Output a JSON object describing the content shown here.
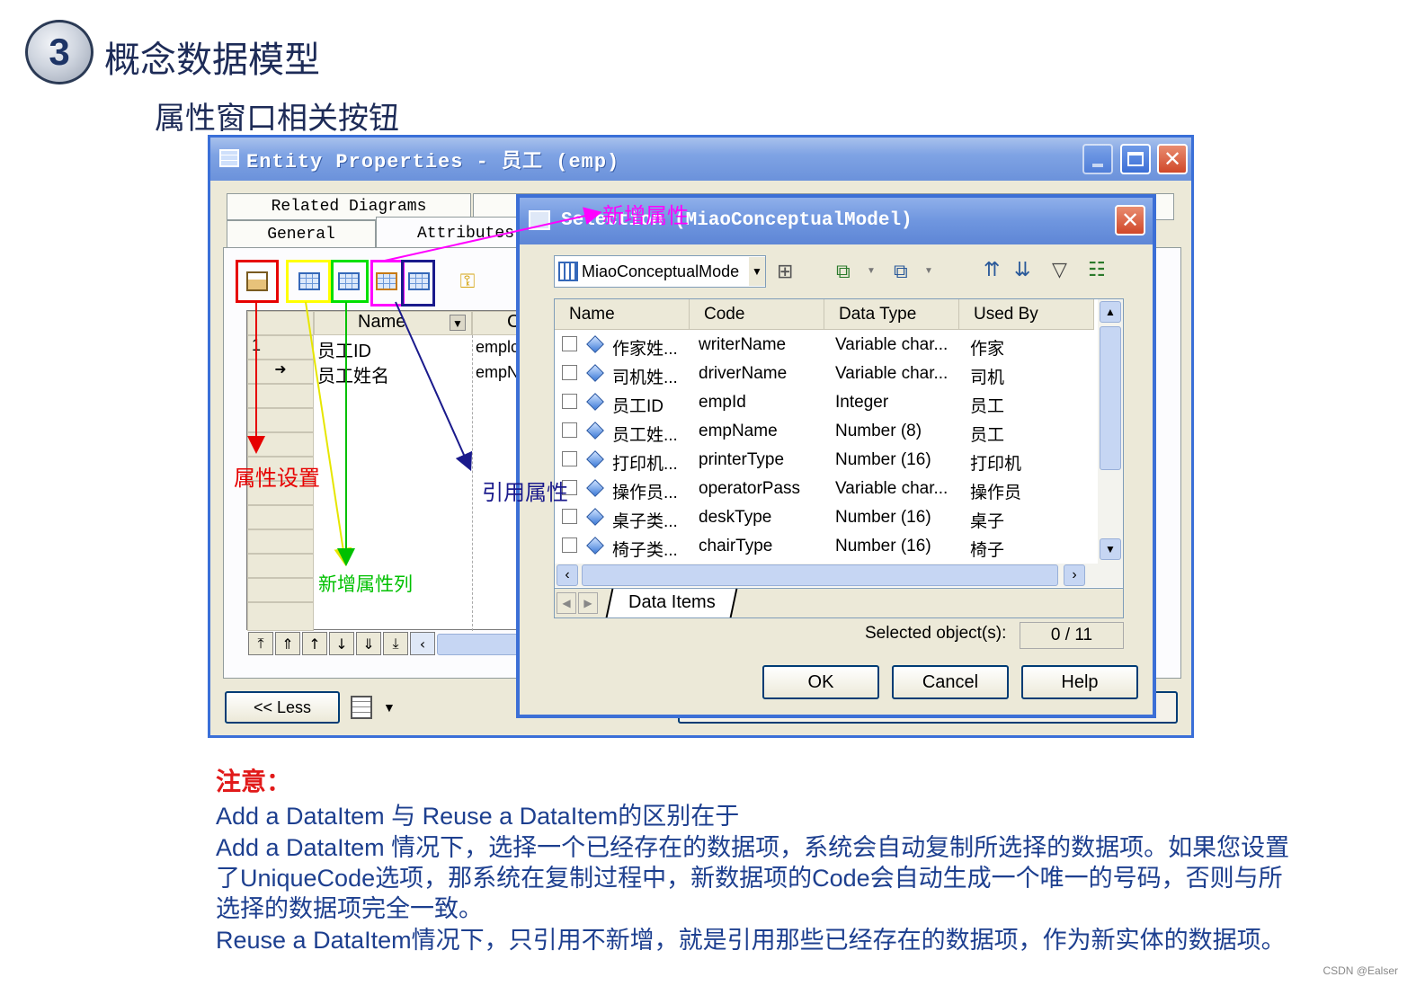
{
  "slide": {
    "number": "3",
    "title": "概念数据模型",
    "subtitle": "属性窗口相关按钮"
  },
  "entity_window": {
    "title": "Entity Properties - 员工 (emp)",
    "tabs_row1": [
      "Related Diagrams",
      ""
    ],
    "tabs_row2": [
      "General",
      "Attributes"
    ],
    "grid": {
      "column_name": "Name",
      "column_code": "C",
      "rows": [
        {
          "num": "1",
          "name": "员工ID",
          "code": "emplc"
        },
        {
          "num": "",
          "name": "员工姓名",
          "code": "empN"
        }
      ]
    },
    "less_button": "<< Less"
  },
  "selection_dialog": {
    "title": "Selection (MiaoConceptualModel)",
    "model_combo": "MiaoConceptualMode",
    "columns": [
      "Name",
      "Code",
      "Data Type",
      "Used By"
    ],
    "rows": [
      {
        "name": "作家姓...",
        "code": "writerName",
        "type": "Variable char...",
        "used_by": "作家"
      },
      {
        "name": "司机姓...",
        "code": "driverName",
        "type": "Variable char...",
        "used_by": "司机"
      },
      {
        "name": "员工ID",
        "code": "empId",
        "type": "Integer",
        "used_by": "员工"
      },
      {
        "name": "员工姓...",
        "code": "empName",
        "type": "Number (8)",
        "used_by": "员工"
      },
      {
        "name": "打印机...",
        "code": "printerType",
        "type": "Number (16)",
        "used_by": "打印机"
      },
      {
        "name": "操作员...",
        "code": "operatorPass",
        "type": "Variable char...",
        "used_by": "操作员"
      },
      {
        "name": "桌子类...",
        "code": "deskType",
        "type": "Number (16)",
        "used_by": "桌子"
      },
      {
        "name": "椅子类...",
        "code": "chairType",
        "type": "Number (16)",
        "used_by": "椅子"
      }
    ],
    "tab_label": "Data Items",
    "selected_label": "Selected object(s):",
    "selected_value": "0 / 11",
    "ok": "OK",
    "cancel": "Cancel",
    "help": "Help"
  },
  "annotations": {
    "add_attribute": "新增属性",
    "attribute_settings": "属性设置",
    "reuse_attribute": "引用属性",
    "add_attribute_column": "新增属性列"
  },
  "colors": {
    "red": "#e60000",
    "yellow": "#ffff00",
    "green": "#00e000",
    "magenta": "#ff00ff",
    "navy": "#1a1a8c"
  },
  "notes": {
    "label": "注意：",
    "lines": [
      "Add a DataItem 与 Reuse a DataItem的区别在于",
      "Add a DataItem 情况下，选择一个已经存在的数据项，系统会自动复制所选择的数据项。如果您设置",
      "了UniqueCode选项，那系统在复制过程中，新数据项的Code会自动生成一个唯一的号码，否则与所",
      "选择的数据项完全一致。",
      "Reuse a DataItem情况下，只引用不新增，就是引用那些已经存在的数据项，作为新实体的数据项。"
    ]
  },
  "credit": "CSDN @Ealser"
}
